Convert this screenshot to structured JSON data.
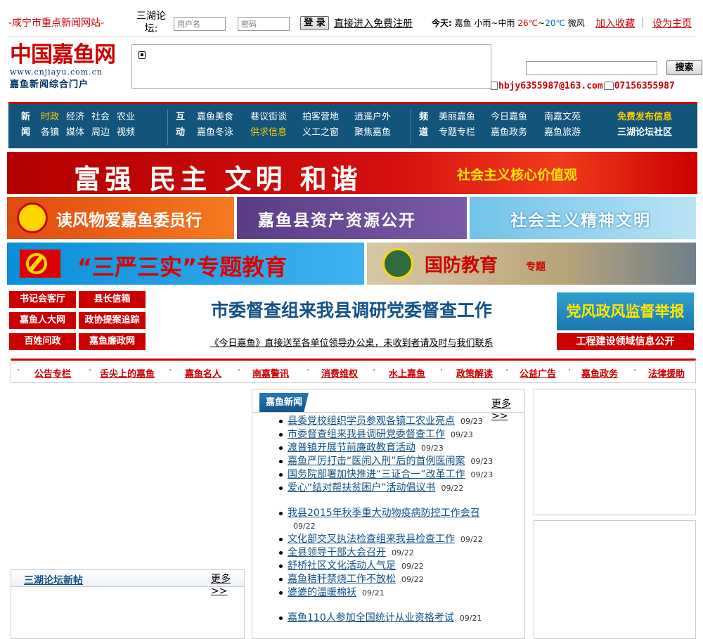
{
  "topbar": {
    "slogan": "-咸宁市重点新闻网站-",
    "forum_label": "三湖论坛:",
    "username_placeholder": "用户名",
    "password_placeholder": "密码",
    "login_button": "登 录",
    "register_link": "直接进入免费注册",
    "weather": {
      "today_label": "今天:",
      "place": "嘉鱼",
      "condition": "小雨~中雨",
      "high": "26℃",
      "tilde": "~",
      "low": "20℃",
      "wind": "微风"
    },
    "favorite_link": "加入收藏",
    "homepage_link": "设为主页"
  },
  "logo": {
    "name": "中国嘉鱼网",
    "url": "www.cnjiayu.com.cn",
    "tagline": "嘉鱼新闻综合门户"
  },
  "search": {
    "button": "搜索"
  },
  "contact": {
    "email": "hbjy6355987@163.com",
    "phone": "07156355987"
  },
  "nav": {
    "group1_head": "新闻",
    "row1a": [
      "时政",
      "经济",
      "社会",
      "农业"
    ],
    "row1b": [
      "各镇",
      "媒体",
      "周边",
      "视频"
    ],
    "group2_head": "互动",
    "row2a": [
      "嘉鱼美食",
      "巷议街谈",
      "拍客营地",
      "逍遥户外"
    ],
    "row2b": [
      "嘉鱼冬泳",
      "供求信息",
      "义工之窗",
      "聚焦嘉鱼"
    ],
    "group3_head": "频道",
    "row3a": [
      "美丽嘉鱼",
      "今日嘉鱼",
      "南嘉文苑"
    ],
    "row3b": [
      "专题专栏",
      "嘉鱼政务",
      "嘉鱼旅游"
    ],
    "free_post": "免费发布信息",
    "forum_zone": "三湖论坛社区"
  },
  "banners": {
    "b1_main": "富强  民主  文明  和谐",
    "b1_sub": "社会主义核心价值观",
    "b2": "读风物爱嘉鱼委员行",
    "b3": "嘉鱼县资产资源公开",
    "b4": "社会主义精神文明",
    "b5": "“三严三实”专题教育",
    "b6_main": "国防教育",
    "b6_sub": "专题"
  },
  "quick_links": [
    "书记会客厅",
    "县长信箱",
    "嘉鱼人大网",
    "政协提案追踪",
    "百姓问政",
    "嘉鱼廉政网"
  ],
  "headline": {
    "title": "市委督查组来我县调研党委督查工作",
    "subline": "《今日嘉鱼》直接送至各单位领导办公桌，未收到者请及时与我们联系"
  },
  "right_banners": {
    "report": "党风政风监督举报",
    "engineering": "工程建设领域信息公开"
  },
  "categories": [
    "公告专栏",
    "舌尖上的嘉鱼",
    "嘉鱼名人",
    "南嘉警讯",
    "消费维权",
    "水上嘉鱼",
    "政策解读",
    "公益广告",
    "嘉鱼政务",
    "法律援助"
  ],
  "forum_box": {
    "title": "三湖论坛新帖",
    "more": "更多>>"
  },
  "news_box": {
    "title": "嘉鱼新闻",
    "more": "更多>>",
    "items": [
      {
        "title": "县委党校组织学员参观各镇工农业亮点",
        "date": "09/23"
      },
      {
        "title": "市委督查组来我县调研党委督查工作",
        "date": "09/23"
      },
      {
        "title": "渡普镇开展节前廉政教育活动",
        "date": "09/23"
      },
      {
        "title": "嘉鱼严厉打击“医闹入刑”后的首例医闹案",
        "date": "09/23"
      },
      {
        "title": "国务院部署加快推进“三证合一”改革工作",
        "date": "09/23"
      },
      {
        "title": "爱心“结对帮扶贫困户”活动倡议书",
        "date": "09/22"
      },
      {
        "title": "我县2015年秋季重大动物疫病防控工作会召",
        "date": "09/22"
      },
      {
        "title": "文化部交叉执法检查组来我县检查工作",
        "date": "09/22"
      },
      {
        "title": "全县领导干部大会召开",
        "date": "09/22"
      },
      {
        "title": "舒桥社区文化活动人气足",
        "date": "09/22"
      },
      {
        "title": "嘉鱼秸秆禁烧工作不放松",
        "date": "09/22"
      },
      {
        "title": "婆婆的温暖棉袄",
        "date": "09/21"
      },
      {
        "title": "嘉鱼110人参加全国统计从业资格考试",
        "date": "09/21"
      }
    ]
  },
  "colors": {
    "brand_red": "#cc0000",
    "nav_blue": "#13557a",
    "link_blue": "#135289",
    "highlight_yellow": "#ffcc00"
  }
}
